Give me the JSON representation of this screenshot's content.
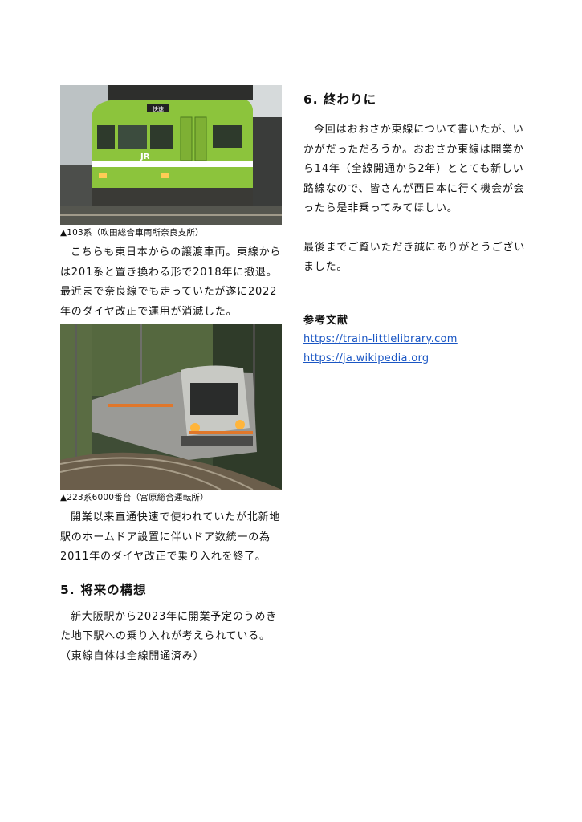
{
  "left": {
    "photo1_caption": "▲103系（吹田総合車両所奈良支所）",
    "para1": "こちらも東日本からの譲渡車両。東線からは201系と置き換わる形で2018年に撤退。最近まで奈良線でも走っていたが遂に2022年のダイヤ改正で運用が消滅した。",
    "photo2_caption": "▲223系6000番台（宮原総合運転所）",
    "para2": "開業以来直通快速で使われていたが北新地駅のホームドア設置に伴いドア数統一の為2011年のダイヤ改正で乗り入れを終了。",
    "section5_heading": "5. 将来の構想",
    "para3": "新大阪駅から2023年に開業予定のうめきた地下駅への乗り入れが考えられている。",
    "para4": "（東線自体は全線開通済み）"
  },
  "right": {
    "section6_heading": "6. 終わりに",
    "para1": "今回はおおさか東線について書いたが、いかがだっただろうか。おおさか東線は開業から14年（全線開通から2年）ととても新しい路線なので、皆さんが西日本に行く機会が会ったら是非乗ってみてほしい。",
    "para2": "最後までご覧いただき誠にありがとうございました。",
    "refs_heading": "参考文献",
    "refs": [
      "https://train-littlelibrary.com",
      "https://ja.wikipedia.org"
    ]
  },
  "photo1_marks": {
    "train_logo": "JR",
    "dest_sign": "快速"
  },
  "colors": {
    "train_green": "#8cc43c",
    "link_blue": "#1a56c4"
  }
}
